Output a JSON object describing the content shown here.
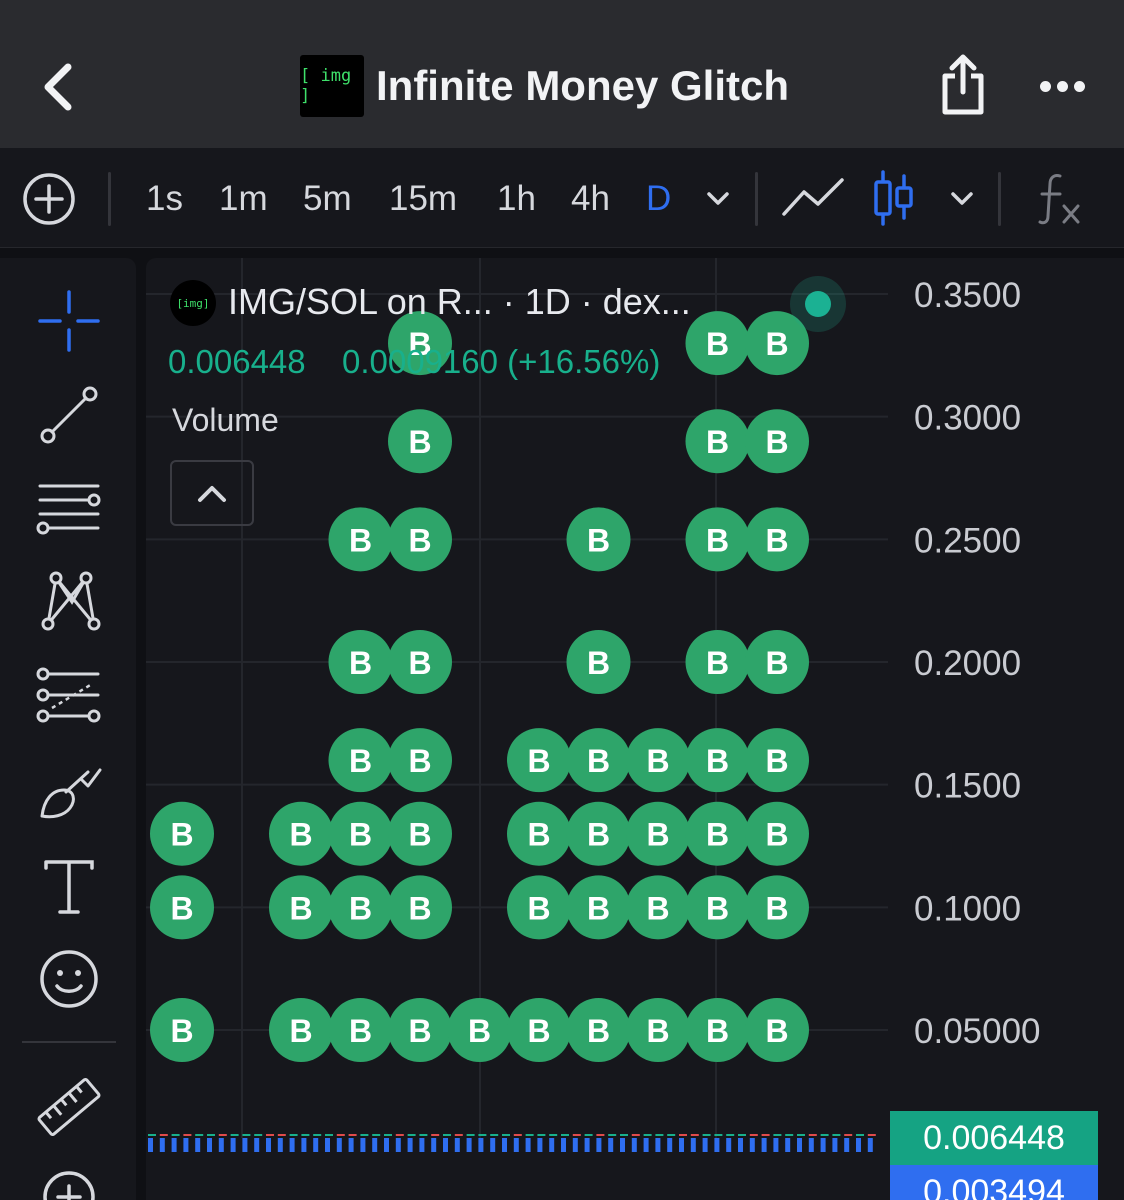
{
  "header": {
    "title": "Infinite Money Glitch",
    "logo_text": "[ img ]",
    "back_icon": "chevron-left-icon",
    "share_icon": "share-icon",
    "more_icon": "more-horizontal-icon"
  },
  "toolbar": {
    "intervals": [
      "1s",
      "1m",
      "5m",
      "15m",
      "1h",
      "4h",
      "D"
    ],
    "active_interval": "D",
    "icons": [
      "plus-circle-icon",
      "chevron-down-icon",
      "line-chart-icon",
      "candlestick-icon",
      "chevron-down-icon",
      "fx-icon"
    ]
  },
  "sidebar": {
    "tools": [
      "crosshair-icon",
      "trendline-icon",
      "horizontal-lines-icon",
      "pattern-icon",
      "fib-icon",
      "brush-icon",
      "text-icon",
      "emoji-icon",
      "ruler-icon",
      "zoom-in-icon"
    ]
  },
  "chart": {
    "legend": {
      "logo_text": "[img]",
      "title": "IMG/SOL on R... · 1D · dex...",
      "last_price": "0.006448",
      "change": "0.0009160 (+16.56%)",
      "volume_label": "Volume"
    },
    "marker_label": "B",
    "price_axis": [
      "0.3500",
      "0.3000",
      "0.2500",
      "0.2000",
      "0.1500",
      "0.1000",
      "0.05000"
    ],
    "price_tags": [
      {
        "value": "0.006448",
        "color": "#15a383"
      },
      {
        "value": "0.003494",
        "color": "#2f6ef0"
      }
    ],
    "colors": {
      "marker": "#2ea56a",
      "up": "#18b08c",
      "down": "#e04b4b",
      "volume": "#2f6ef0",
      "active": "#2f6ef0"
    }
  },
  "chart_data": {
    "type": "scatter",
    "title": "",
    "xlabel": "",
    "ylabel": "",
    "ylim": [
      0.03,
      0.37
    ],
    "y_ticks": [
      0.35,
      0.3,
      0.25,
      0.2,
      0.15,
      0.1,
      0.05
    ],
    "series": [
      {
        "name": "",
        "label": "B",
        "x": [
          0,
          0,
          0,
          2,
          2,
          2,
          3,
          3,
          3,
          3,
          3,
          3,
          4,
          4,
          4,
          4,
          4,
          4,
          4,
          4,
          5,
          6,
          6,
          6,
          6,
          7,
          7,
          7,
          7,
          7,
          7,
          8,
          8,
          8,
          8,
          9,
          9,
          9,
          9,
          9,
          9,
          9,
          9,
          10,
          10,
          10,
          10,
          10,
          10,
          10,
          10
        ],
        "y": [
          0.05,
          0.1,
          0.13,
          0.05,
          0.1,
          0.13,
          0.05,
          0.1,
          0.13,
          0.16,
          0.2,
          0.25,
          0.05,
          0.1,
          0.13,
          0.16,
          0.2,
          0.25,
          0.29,
          0.33,
          0.05,
          0.05,
          0.1,
          0.13,
          0.16,
          0.05,
          0.1,
          0.13,
          0.16,
          0.2,
          0.25,
          0.05,
          0.1,
          0.13,
          0.16,
          0.05,
          0.1,
          0.13,
          0.16,
          0.2,
          0.25,
          0.29,
          0.33,
          0.05,
          0.1,
          0.13,
          0.16,
          0.2,
          0.25,
          0.29,
          0.33
        ]
      }
    ]
  }
}
